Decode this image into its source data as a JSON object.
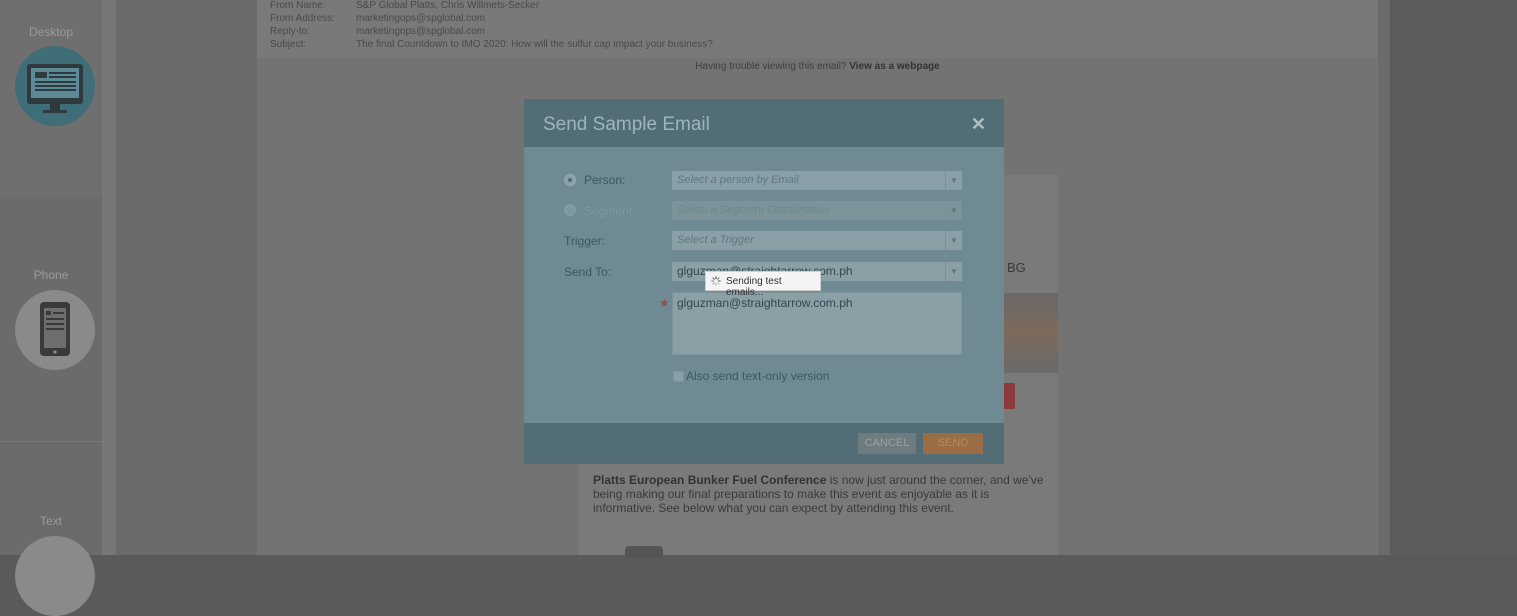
{
  "sidebar": {
    "modes": [
      {
        "label": "Desktop",
        "icon": "desktop-monitor-icon"
      },
      {
        "label": "Phone",
        "icon": "phone-icon"
      },
      {
        "label": "Text",
        "icon": "text-icon"
      }
    ]
  },
  "email_headers": [
    {
      "key": "From Name:",
      "value": "S&P Global Platts, Chris Willmets-Secker"
    },
    {
      "key": "From Address:",
      "value": "marketingops@spglobal.com"
    },
    {
      "key": "Reply-to:",
      "value": "marketingops@spglobal.com"
    },
    {
      "key": "Subject:",
      "value": "The final Countdown to IMO 2020: How will the sulfur cap impact your business?"
    }
  ],
  "trouble_text": "Having trouble viewing this email?",
  "trouble_link": "View as a webpage",
  "email_body": {
    "partial_text": "BG",
    "para_bold": "Platts European Bunker Fuel Conference",
    "para_rest": " is now just around the corner, and we've being making our final preparations to make this event as enjoyable as it is informative. See below what you can expect by attending this event."
  },
  "modal": {
    "title": "Send Sample Email",
    "close_icon": "close-icon",
    "person_label": "Person:",
    "person_placeholder": "Select a person by Email",
    "segment_label": "Segment:",
    "segment_placeholder": "Select a Segment Combination",
    "trigger_label": "Trigger:",
    "trigger_placeholder": "Select a Trigger",
    "send_to_label": "Send To:",
    "send_to_value": "glguzman@straightarrow.com.ph",
    "send_to_list": "glguzman@straightarrow.com.ph",
    "text_only_label": "Also send text-only version",
    "cancel_label": "CANCEL",
    "send_label": "SEND"
  },
  "toast": {
    "text": "Sending test emails..."
  },
  "colors": {
    "overlay_dark": "#5a5a5a",
    "modal_header": "#536d76",
    "modal_body": "#6f8a92",
    "send_button": "#9a6d45",
    "desktop_active": "#3f6d78"
  }
}
